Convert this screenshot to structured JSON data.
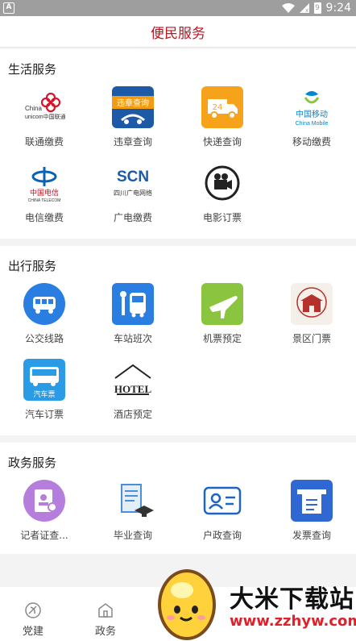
{
  "status_bar": {
    "app_badge": "A",
    "time": "9:24",
    "battery": "9"
  },
  "header": {
    "title": "便民服务"
  },
  "sections": [
    {
      "title": "生活服务",
      "items": [
        {
          "label": "联通缴费",
          "icon": "china-unicom-logo"
        },
        {
          "label": "违章查询",
          "icon": "violation-query-icon",
          "icon_text": "违章查询"
        },
        {
          "label": "快递查询",
          "icon": "delivery-truck-icon",
          "icon_text": "24"
        },
        {
          "label": "移动缴费",
          "icon": "china-mobile-logo",
          "icon_text": "中国移动",
          "icon_sub": "China Mobile"
        },
        {
          "label": "电信缴费",
          "icon": "china-telecom-logo",
          "icon_text": "中国电信",
          "icon_sub": "CHINA TELECOM"
        },
        {
          "label": "广电缴费",
          "icon": "scn-logo",
          "icon_text": "SCN",
          "icon_sub": "四川广电网络"
        },
        {
          "label": "电影订票",
          "icon": "film-camera-icon"
        }
      ]
    },
    {
      "title": "出行服务",
      "items": [
        {
          "label": "公交线路",
          "icon": "bus-icon"
        },
        {
          "label": "车站班次",
          "icon": "bus-stop-icon"
        },
        {
          "label": "机票预定",
          "icon": "airplane-icon"
        },
        {
          "label": "景区门票",
          "icon": "scenic-gate-icon"
        },
        {
          "label": "汽车订票",
          "icon": "coach-ticket-icon",
          "icon_text": "汽车票"
        },
        {
          "label": "酒店预定",
          "icon": "hotel-icon",
          "icon_text": "HOTEL"
        }
      ]
    },
    {
      "title": "政务服务",
      "items": [
        {
          "label": "记者证查...",
          "icon": "press-card-icon"
        },
        {
          "label": "毕业查询",
          "icon": "graduation-icon"
        },
        {
          "label": "户政查询",
          "icon": "id-card-icon"
        },
        {
          "label": "发票查询",
          "icon": "invoice-icon"
        }
      ]
    }
  ],
  "tabbar": {
    "items": [
      {
        "label": "党建",
        "icon": "party-emblem-icon"
      },
      {
        "label": "政务",
        "icon": "government-icon"
      }
    ]
  },
  "watermark": {
    "title": "大米下载站",
    "url": "www.zzhyw.com"
  },
  "colors": {
    "title_red": "#c1121f",
    "blue": "#2a7de1",
    "orange": "#f7a21b",
    "green": "#8bc53f"
  }
}
